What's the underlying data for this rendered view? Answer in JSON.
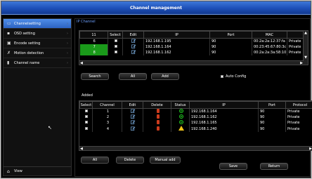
{
  "window": {
    "title": "Channel management"
  },
  "sidebar": {
    "items": [
      {
        "label": "Channelsetting",
        "icon": "camera-icon",
        "selected": true
      },
      {
        "label": "OSD setting",
        "icon": "osd-icon",
        "selected": false
      },
      {
        "label": "Encode setting",
        "icon": "encode-icon",
        "selected": false
      },
      {
        "label": "Motion detection",
        "icon": "motion-icon",
        "selected": false
      },
      {
        "label": "Channel name",
        "icon": "document-icon",
        "selected": false
      }
    ],
    "view_label": "View"
  },
  "main": {
    "title": "IP Channel"
  },
  "search_table": {
    "columns": [
      "11",
      "Select",
      "Edit",
      "IP",
      "Port",
      "MAC",
      ""
    ],
    "rows": [
      {
        "num": "6",
        "ip": "192.168.1.195",
        "port": "90",
        "mac": "00:2a:2a:12:37:fa",
        "protocol": "Private",
        "green": false
      },
      {
        "num": "7",
        "ip": "192.168.1.164",
        "port": "90",
        "mac": "00:23:45:67:80:3c",
        "protocol": "Private",
        "green": true
      },
      {
        "num": "8",
        "ip": "192.168.1.162",
        "port": "90",
        "mac": "00:2a:2a:3a:58:10",
        "protocol": "Private",
        "green": true
      }
    ]
  },
  "buttons": {
    "search": "Search",
    "all_top": "All",
    "add": "Add",
    "auto_config": "Auto Config",
    "all_bottom": "All",
    "delete": "Delete",
    "manual_add": "Manual add",
    "save": "Save",
    "return": "Return"
  },
  "added_section": {
    "title": "Added"
  },
  "added_table": {
    "columns": [
      "Select",
      "Channel",
      "Edit",
      "Delete",
      "Status",
      "IP",
      "Port",
      "Protocol"
    ],
    "rows": [
      {
        "channel": "1",
        "status": "ok",
        "ip": "192.168.1.164",
        "port": "90",
        "protocol": "Private"
      },
      {
        "channel": "2",
        "status": "ok",
        "ip": "192.168.1.162",
        "port": "90",
        "protocol": "Private"
      },
      {
        "channel": "3",
        "status": "ok",
        "ip": "192.168.1.165",
        "port": "90",
        "protocol": "Private"
      },
      {
        "channel": "4",
        "status": "warning",
        "ip": "192.168.1.240",
        "port": "90",
        "protocol": "Private"
      }
    ]
  }
}
